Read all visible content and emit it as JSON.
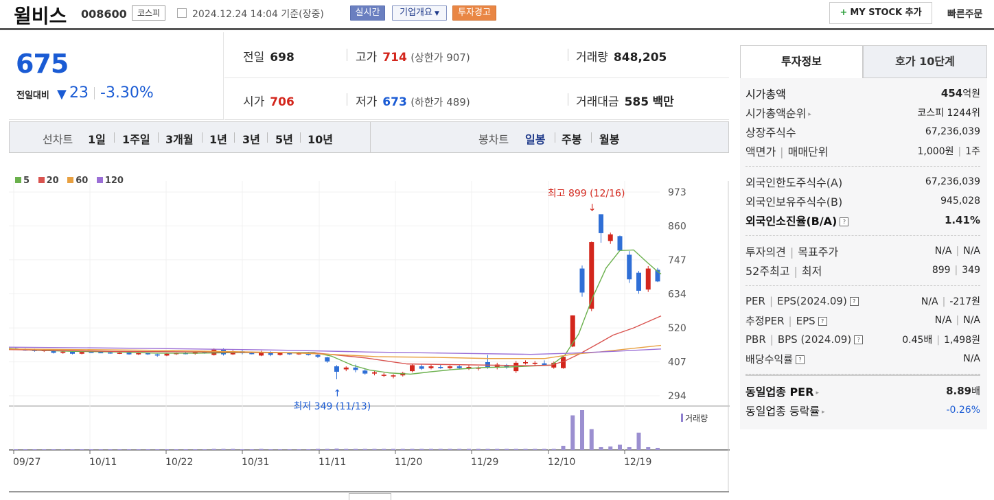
{
  "header": {
    "name": "윌비스",
    "code": "008600",
    "market": "코스피",
    "datetime": "2024.12.24 14:04 기준(장중)",
    "realtime_btn": "실시간",
    "company_btn": "기업개요",
    "company_arrow": "▼",
    "warning_btn": "투자경고",
    "mystock_btn": "MY STOCK 추가",
    "mystock_plus": "+",
    "quick_order": "빠른주문"
  },
  "price": {
    "current": "675",
    "change_label": "전일대비",
    "change_arrow": "▼",
    "change_value": "23",
    "change_pct": "-3.30%"
  },
  "quote": {
    "prev_label": "전일",
    "prev": "698",
    "high_label": "고가",
    "high": "714",
    "upper_limit": "(상한가 907)",
    "volume_label": "거래량",
    "volume": "848,205",
    "open_label": "시가",
    "open": "706",
    "low_label": "저가",
    "low": "673",
    "lower_limit": "(하한가 489)",
    "amount_label": "거래대금",
    "amount": "585",
    "amount_unit": "백만"
  },
  "periods": {
    "line_label": "선차트",
    "line_items": [
      "1일",
      "1주일",
      "3개월",
      "1년",
      "3년",
      "5년",
      "10년"
    ],
    "candle_label": "봉차트",
    "candle_items": [
      "일봉",
      "주봉",
      "월봉"
    ]
  },
  "chart_data": {
    "type": "candlestick",
    "legend": [
      {
        "name": "5",
        "color": "#6ab04c"
      },
      {
        "name": "20",
        "color": "#d9534f"
      },
      {
        "name": "60",
        "color": "#e8a040"
      },
      {
        "name": "120",
        "color": "#9b6fd6"
      }
    ],
    "y_ticks": [
      "973",
      "860",
      "747",
      "634",
      "520",
      "407",
      "294"
    ],
    "ylim": [
      294,
      973
    ],
    "x_ticks": [
      "09/27",
      "10/11",
      "10/22",
      "10/31",
      "11/11",
      "11/20",
      "11/29",
      "12/10",
      "12/19"
    ],
    "annotations": {
      "high": "최고 899 (12/16)",
      "low": "최저 349 (11/13)"
    },
    "volume_label": "거래량",
    "up_color": "#d3261c",
    "down_color": "#2f6fd6",
    "candles": [
      {
        "o": 452,
        "h": 455,
        "l": 446,
        "c": 448
      },
      {
        "o": 448,
        "h": 452,
        "l": 444,
        "c": 447
      },
      {
        "o": 447,
        "h": 451,
        "l": 441,
        "c": 443
      },
      {
        "o": 443,
        "h": 448,
        "l": 440,
        "c": 446
      },
      {
        "o": 446,
        "h": 448,
        "l": 435,
        "c": 437
      },
      {
        "o": 437,
        "h": 444,
        "l": 434,
        "c": 441
      },
      {
        "o": 441,
        "h": 444,
        "l": 432,
        "c": 434
      },
      {
        "o": 434,
        "h": 442,
        "l": 432,
        "c": 440
      },
      {
        "o": 440,
        "h": 443,
        "l": 437,
        "c": 439
      },
      {
        "o": 439,
        "h": 442,
        "l": 436,
        "c": 438
      },
      {
        "o": 438,
        "h": 441,
        "l": 434,
        "c": 436
      },
      {
        "o": 436,
        "h": 440,
        "l": 433,
        "c": 437
      },
      {
        "o": 437,
        "h": 439,
        "l": 431,
        "c": 432
      },
      {
        "o": 432,
        "h": 438,
        "l": 430,
        "c": 436
      },
      {
        "o": 436,
        "h": 438,
        "l": 430,
        "c": 432
      },
      {
        "o": 432,
        "h": 434,
        "l": 424,
        "c": 428
      },
      {
        "o": 428,
        "h": 436,
        "l": 426,
        "c": 434
      },
      {
        "o": 434,
        "h": 438,
        "l": 430,
        "c": 436
      },
      {
        "o": 436,
        "h": 440,
        "l": 432,
        "c": 434
      },
      {
        "o": 434,
        "h": 442,
        "l": 431,
        "c": 440
      },
      {
        "o": 440,
        "h": 444,
        "l": 434,
        "c": 436
      },
      {
        "o": 430,
        "h": 452,
        "l": 428,
        "c": 448
      },
      {
        "o": 448,
        "h": 452,
        "l": 428,
        "c": 432
      },
      {
        "o": 432,
        "h": 446,
        "l": 430,
        "c": 442
      },
      {
        "o": 442,
        "h": 446,
        "l": 432,
        "c": 436
      },
      {
        "o": 436,
        "h": 441,
        "l": 432,
        "c": 434
      },
      {
        "o": 428,
        "h": 444,
        "l": 426,
        "c": 440
      },
      {
        "o": 440,
        "h": 442,
        "l": 426,
        "c": 430
      },
      {
        "o": 430,
        "h": 438,
        "l": 428,
        "c": 436
      },
      {
        "o": 436,
        "h": 438,
        "l": 430,
        "c": 432
      },
      {
        "o": 432,
        "h": 440,
        "l": 430,
        "c": 438
      },
      {
        "o": 438,
        "h": 440,
        "l": 428,
        "c": 430
      },
      {
        "o": 430,
        "h": 433,
        "l": 420,
        "c": 424
      },
      {
        "o": 422,
        "h": 424,
        "l": 404,
        "c": 408
      },
      {
        "o": 392,
        "h": 396,
        "l": 349,
        "c": 374
      },
      {
        "o": 382,
        "h": 392,
        "l": 376,
        "c": 388
      },
      {
        "o": 388,
        "h": 398,
        "l": 372,
        "c": 380
      },
      {
        "o": 378,
        "h": 384,
        "l": 364,
        "c": 368
      },
      {
        "o": 368,
        "h": 376,
        "l": 362,
        "c": 372
      },
      {
        "o": 362,
        "h": 370,
        "l": 356,
        "c": 364
      },
      {
        "o": 358,
        "h": 366,
        "l": 352,
        "c": 362
      },
      {
        "o": 362,
        "h": 374,
        "l": 358,
        "c": 370
      },
      {
        "o": 376,
        "h": 400,
        "l": 372,
        "c": 396
      },
      {
        "o": 392,
        "h": 398,
        "l": 380,
        "c": 384
      },
      {
        "o": 386,
        "h": 398,
        "l": 382,
        "c": 392
      },
      {
        "o": 390,
        "h": 398,
        "l": 384,
        "c": 386
      },
      {
        "o": 386,
        "h": 396,
        "l": 382,
        "c": 392
      },
      {
        "o": 392,
        "h": 398,
        "l": 384,
        "c": 386
      },
      {
        "o": 384,
        "h": 398,
        "l": 380,
        "c": 390
      },
      {
        "o": 384,
        "h": 392,
        "l": 378,
        "c": 388
      },
      {
        "o": 406,
        "h": 430,
        "l": 384,
        "c": 390
      },
      {
        "o": 390,
        "h": 404,
        "l": 382,
        "c": 398
      },
      {
        "o": 394,
        "h": 400,
        "l": 384,
        "c": 388
      },
      {
        "o": 376,
        "h": 410,
        "l": 370,
        "c": 404
      },
      {
        "o": 402,
        "h": 412,
        "l": 398,
        "c": 406
      },
      {
        "o": 400,
        "h": 410,
        "l": 394,
        "c": 404
      },
      {
        "o": 402,
        "h": 412,
        "l": 394,
        "c": 396
      },
      {
        "o": 388,
        "h": 408,
        "l": 384,
        "c": 404
      },
      {
        "o": 386,
        "h": 428,
        "l": 384,
        "c": 424
      },
      {
        "o": 458,
        "h": 562,
        "l": 456,
        "c": 562
      },
      {
        "o": 718,
        "h": 728,
        "l": 624,
        "c": 638
      },
      {
        "o": 584,
        "h": 808,
        "l": 576,
        "c": 806
      },
      {
        "o": 899,
        "h": 899,
        "l": 804,
        "c": 836
      },
      {
        "o": 810,
        "h": 838,
        "l": 800,
        "c": 832
      },
      {
        "o": 826,
        "h": 828,
        "l": 776,
        "c": 778
      },
      {
        "o": 764,
        "h": 776,
        "l": 670,
        "c": 682
      },
      {
        "o": 704,
        "h": 710,
        "l": 634,
        "c": 644
      },
      {
        "o": 648,
        "h": 726,
        "l": 640,
        "c": 718
      },
      {
        "o": 714,
        "h": 720,
        "l": 673,
        "c": 675
      }
    ],
    "ma5": [
      [
        0,
        452
      ],
      [
        33,
        446
      ],
      [
        95,
        442
      ],
      [
        160,
        440
      ],
      [
        215,
        436
      ],
      [
        275,
        436
      ],
      [
        335,
        438
      ],
      [
        395,
        438
      ],
      [
        445,
        438
      ],
      [
        470,
        426
      ],
      [
        500,
        396
      ],
      [
        525,
        380
      ],
      [
        555,
        370
      ],
      [
        585,
        366
      ],
      [
        615,
        374
      ],
      [
        650,
        382
      ],
      [
        690,
        388
      ],
      [
        730,
        390
      ],
      [
        770,
        394
      ],
      [
        790,
        396
      ],
      [
        810,
        430
      ],
      [
        830,
        500
      ],
      [
        850,
        620
      ],
      [
        870,
        720
      ],
      [
        890,
        778
      ],
      [
        910,
        780
      ],
      [
        930,
        738
      ],
      [
        945,
        708
      ],
      [
        950,
        700
      ]
    ],
    "ma20": [
      [
        0,
        448
      ],
      [
        150,
        442
      ],
      [
        300,
        440
      ],
      [
        450,
        436
      ],
      [
        520,
        420
      ],
      [
        580,
        400
      ],
      [
        640,
        398
      ],
      [
        700,
        396
      ],
      [
        760,
        394
      ],
      [
        790,
        396
      ],
      [
        810,
        410
      ],
      [
        830,
        432
      ],
      [
        860,
        470
      ],
      [
        880,
        496
      ],
      [
        910,
        520
      ],
      [
        950,
        560
      ]
    ],
    "ma60": [
      [
        0,
        450
      ],
      [
        200,
        446
      ],
      [
        400,
        438
      ],
      [
        470,
        432
      ],
      [
        540,
        424
      ],
      [
        620,
        422
      ],
      [
        700,
        418
      ],
      [
        780,
        418
      ],
      [
        820,
        432
      ],
      [
        860,
        440
      ],
      [
        950,
        462
      ]
    ],
    "ma120": [
      [
        0,
        456
      ],
      [
        200,
        452
      ],
      [
        400,
        446
      ],
      [
        520,
        440
      ],
      [
        640,
        436
      ],
      [
        760,
        432
      ],
      [
        820,
        436
      ],
      [
        880,
        442
      ],
      [
        950,
        450
      ]
    ],
    "volumes": [
      2,
      2,
      2,
      2,
      2,
      2,
      2,
      2,
      2,
      2,
      2,
      2,
      2,
      2,
      2,
      2,
      2,
      2,
      2,
      2,
      2,
      3,
      3,
      3,
      2,
      2,
      3,
      2,
      2,
      2,
      2,
      2,
      3,
      3,
      4,
      3,
      3,
      3,
      3,
      3,
      3,
      3,
      3,
      3,
      3,
      3,
      3,
      3,
      3,
      3,
      3,
      3,
      3,
      3,
      3,
      3,
      3,
      3,
      12,
      100,
      115,
      60,
      8,
      10,
      15,
      8,
      50,
      8,
      6
    ]
  },
  "side": {
    "tab_active": "투자정보",
    "tab_other": "호가 10단계",
    "market_cap_label": "시가총액",
    "market_cap_value": "454",
    "market_cap_unit": "억원",
    "rank_label": "시가총액순위",
    "rank_value": "코스피 1244위",
    "shares_label": "상장주식수",
    "shares_value": "67,236,039",
    "par_label": "액면가",
    "unit_label": "매매단위",
    "par_value": "1,000원",
    "unit_value": "1주",
    "foreign_limit_label": "외국인한도주식수(A)",
    "foreign_limit_value": "67,236,039",
    "foreign_own_label": "외국인보유주식수(B)",
    "foreign_own_value": "945,028",
    "foreign_ratio_label": "외국인소진율(B/A)",
    "foreign_ratio_value": "1.41%",
    "opinion_label": "투자의견",
    "target_label": "목표주가",
    "opinion_value": "N/A",
    "target_value": "N/A",
    "w52_high_label": "52주최고",
    "w52_low_label": "최저",
    "w52_high": "899",
    "w52_low": "349",
    "per_label": "PER",
    "eps_label": "EPS(2024.09)",
    "per_value": "N/A",
    "eps_value": "-217원",
    "est_per_label": "추정PER",
    "est_eps_label": "EPS",
    "est_per_value": "N/A",
    "est_eps_value": "N/A",
    "pbr_label": "PBR",
    "bps_label": "BPS (2024.09)",
    "pbr_value": "0.45배",
    "bps_value": "1,498원",
    "div_label": "배당수익률",
    "div_value": "N/A",
    "ind_per_label": "동일업종 PER",
    "ind_per_value": "8.89",
    "ind_per_unit": "배",
    "ind_chg_label": "동일업종 등락률",
    "ind_chg_value": "-0.26%",
    "hint_glyph": "?",
    "arrow_glyph": "▸",
    "sep_glyph": "|"
  }
}
